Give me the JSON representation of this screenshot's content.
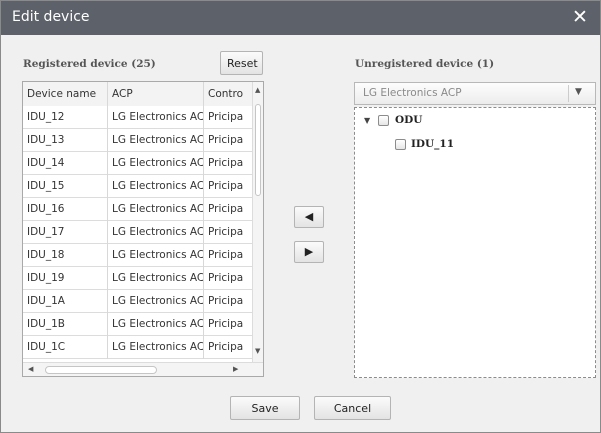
{
  "dialog": {
    "title": "Edit device",
    "close_icon": "close-icon"
  },
  "registered": {
    "label": "Registered device (25)",
    "reset_label": "Reset",
    "columns": [
      "Device name",
      "ACP",
      "Contro"
    ],
    "rows": [
      [
        "IDU_12",
        "LG Electronics ACP",
        "Pricipa"
      ],
      [
        "IDU_13",
        "LG Electronics ACP",
        "Pricipa"
      ],
      [
        "IDU_14",
        "LG Electronics ACP",
        "Pricipa"
      ],
      [
        "IDU_15",
        "LG Electronics ACP",
        "Pricipa"
      ],
      [
        "IDU_16",
        "LG Electronics ACP",
        "Pricipa"
      ],
      [
        "IDU_17",
        "LG Electronics ACP",
        "Pricipa"
      ],
      [
        "IDU_18",
        "LG Electronics ACP",
        "Pricipa"
      ],
      [
        "IDU_19",
        "LG Electronics ACP",
        "Pricipa"
      ],
      [
        "IDU_1A",
        "LG Electronics ACP",
        "Pricipa"
      ],
      [
        "IDU_1B",
        "LG Electronics ACP",
        "Pricipa"
      ],
      [
        "IDU_1C",
        "LG Electronics ACP",
        "Pricipa"
      ]
    ]
  },
  "move": {
    "left_glyph": "◀",
    "right_glyph": "▶"
  },
  "unregistered": {
    "label": "Unregistered device (1)",
    "combo_value": "LG Electronics ACP",
    "tree": {
      "root": {
        "label": "ODU",
        "expanded": true,
        "checked": false
      },
      "children": [
        {
          "label": "IDU_11",
          "checked": false
        }
      ]
    }
  },
  "footer": {
    "save_label": "Save",
    "cancel_label": "Cancel"
  },
  "colors": {
    "titlebar": "#5d6169",
    "dialog_bg": "#f0f0f0"
  }
}
